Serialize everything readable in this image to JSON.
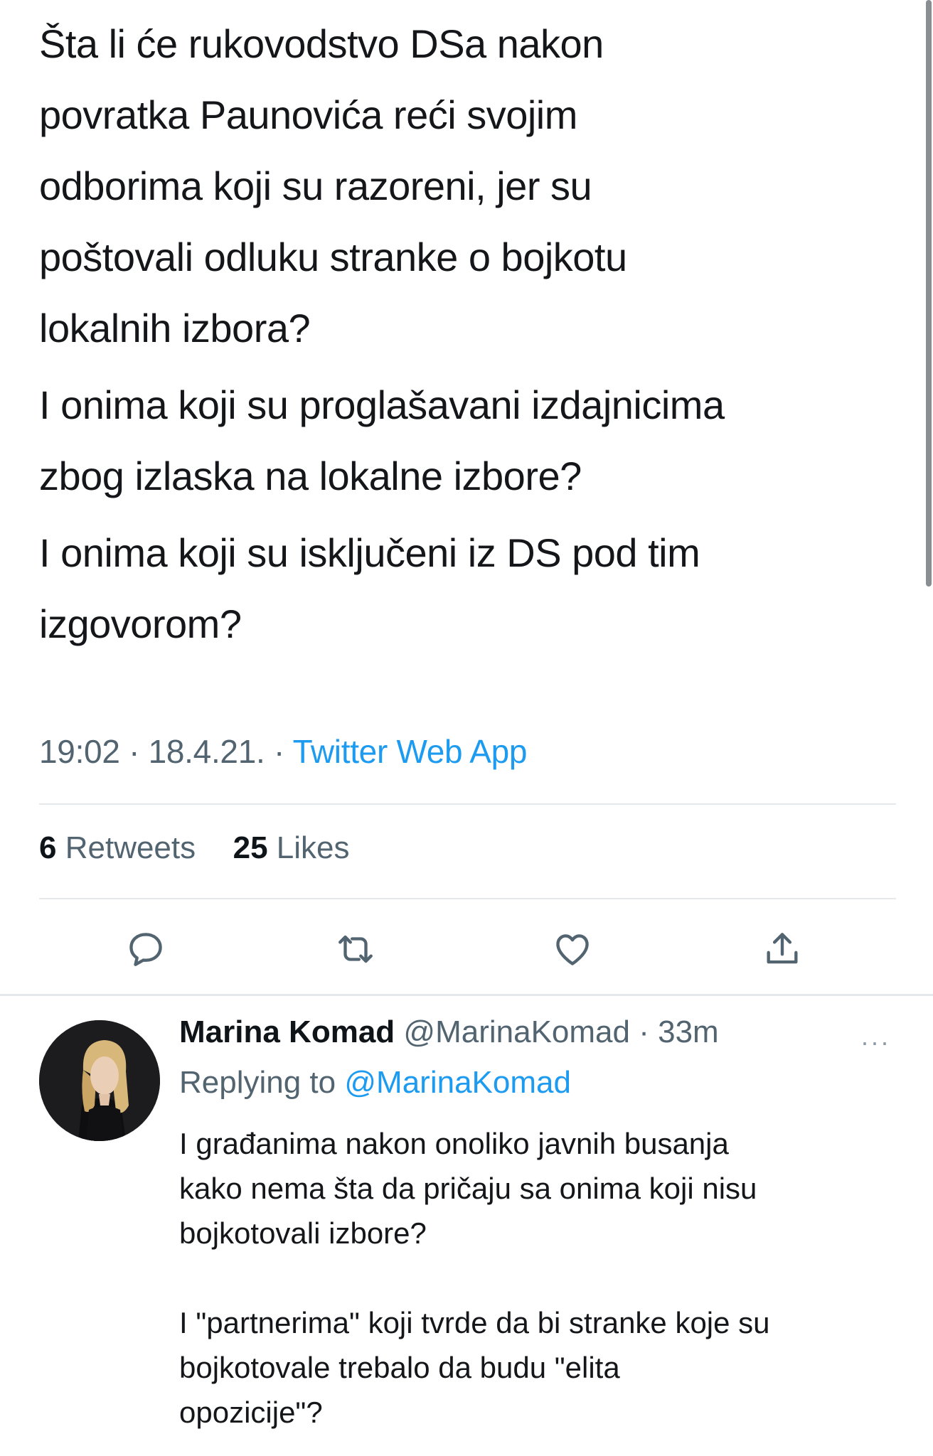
{
  "tweet": {
    "paragraphs": [
      "Šta li će rukovodstvo DSa nakon povratka Paunovića reći svojim odborima koji su razoreni, jer su poštovali odluku stranke o bojkotu lokalnih izbora?",
      "I onima koji su proglašavani izdajnicima zbog izlaska na lokalne izbore?",
      "I onima koji su isključeni iz DS pod tim izgovorom?"
    ],
    "paragraph_lines": [
      [
        "Šta li će rukovodstvo DSa nakon",
        "povratka Paunovića reći svojim",
        "odborima koji su razoreni, jer su",
        "poštovali odluku stranke o bojkotu",
        "lokalnih izbora?"
      ],
      [
        "I onima koji su proglašavani izdajnicima",
        "zbog izlaska na lokalne izbore?"
      ],
      [
        "I onima koji su isključeni iz DS pod tim",
        "izgovorom?"
      ]
    ],
    "time": "19:02",
    "date": "18.4.21.",
    "source": "Twitter Web App",
    "retweets_count": "6",
    "retweets_label": "Retweets",
    "likes_count": "25",
    "likes_label": "Likes"
  },
  "actions": {
    "icons": [
      "reply-icon",
      "retweet-icon",
      "like-icon",
      "share-icon"
    ]
  },
  "reply": {
    "name": "Marina Komad",
    "handle": "@MarinaKomad",
    "time_ago": "33m",
    "more": "···",
    "replying_prefix": "Replying to",
    "replying_to": "@MarinaKomad",
    "paragraph_lines": [
      [
        "I građanima nakon onoliko javnih busanja",
        "kako nema šta da pričaju sa onima koji nisu",
        "bojkotovali izbore?"
      ],
      [
        "I \"partnerima\" koji tvrde da bi stranke koje su",
        "bojkotovale trebalo da budu \"elita",
        "opozicije\"?"
      ]
    ]
  },
  "colors": {
    "link": "#1d9bf0",
    "secondary_text": "#536471",
    "primary_text": "#0f1419",
    "divider": "#e6e9ec"
  }
}
